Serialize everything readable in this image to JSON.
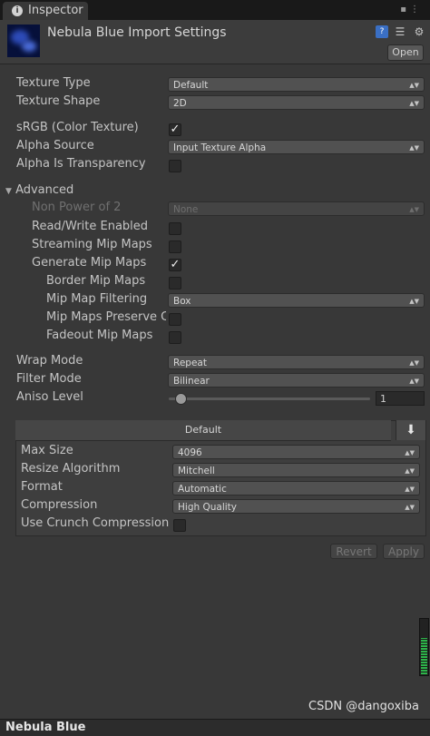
{
  "tab": {
    "label": "Inspector"
  },
  "header": {
    "title": "Nebula Blue Import Settings",
    "open_label": "Open"
  },
  "fields": {
    "texture_type": {
      "label": "Texture Type",
      "value": "Default"
    },
    "texture_shape": {
      "label": "Texture Shape",
      "value": "2D"
    },
    "srgb": {
      "label": "sRGB (Color Texture)",
      "checked": true
    },
    "alpha_source": {
      "label": "Alpha Source",
      "value": "Input Texture Alpha"
    },
    "alpha_transparency": {
      "label": "Alpha Is Transparency",
      "checked": false
    },
    "advanced": {
      "label": "Advanced"
    },
    "non_power_of_2": {
      "label": "Non Power of 2",
      "value": "None"
    },
    "read_write": {
      "label": "Read/Write Enabled",
      "checked": false
    },
    "streaming_mips": {
      "label": "Streaming Mip Maps",
      "checked": false
    },
    "generate_mips": {
      "label": "Generate Mip Maps",
      "checked": true
    },
    "border_mips": {
      "label": "Border Mip Maps",
      "checked": false
    },
    "mip_filtering": {
      "label": "Mip Map Filtering",
      "value": "Box"
    },
    "preserve_coverage": {
      "label": "Mip Maps Preserve Coverage",
      "checked": false
    },
    "fadeout_mips": {
      "label": "Fadeout Mip Maps",
      "checked": false
    },
    "wrap_mode": {
      "label": "Wrap Mode",
      "value": "Repeat"
    },
    "filter_mode": {
      "label": "Filter Mode",
      "value": "Bilinear"
    },
    "aniso_level": {
      "label": "Aniso Level",
      "value": "1",
      "slider_fraction": 0.06
    }
  },
  "platform": {
    "tab_label": "Default",
    "max_size": {
      "label": "Max Size",
      "value": "4096"
    },
    "resize_algorithm": {
      "label": "Resize Algorithm",
      "value": "Mitchell"
    },
    "format": {
      "label": "Format",
      "value": "Automatic"
    },
    "compression": {
      "label": "Compression",
      "value": "High Quality"
    },
    "crunch": {
      "label": "Use Crunch Compression",
      "checked": false
    }
  },
  "actions": {
    "revert_label": "Revert",
    "apply_label": "Apply"
  },
  "footer": {
    "asset_name": "Nebula Blue",
    "watermark": "CSDN @dangoxiba"
  },
  "colors": {
    "background": "#383838",
    "accent_meter": "#2db44a",
    "help_icon": "#3a6fc4"
  },
  "icons": [
    "info-icon",
    "lock-icon",
    "menu-icon",
    "help-icon",
    "presets-icon",
    "gear-icon",
    "download-icon",
    "foldout-arrow-icon"
  ]
}
